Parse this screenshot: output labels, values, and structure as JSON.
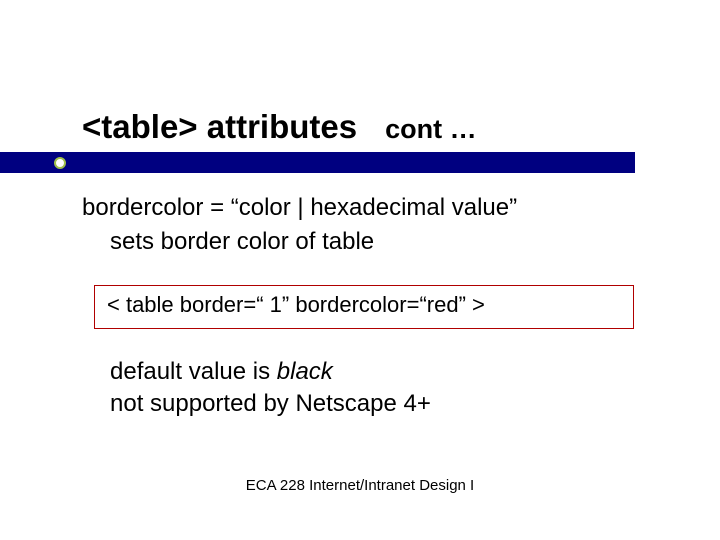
{
  "title": {
    "main": "<table> attributes",
    "cont": "cont …"
  },
  "body": {
    "line1": "bordercolor = “color | hexadecimal value”",
    "line2": "sets border color of table",
    "code": "< table border=“ 1” bordercolor=“red” >",
    "line3_prefix": "default value is ",
    "line3_italic": "black",
    "line4": "not supported by Netscape 4+"
  },
  "footer": "ECA 228  Internet/Intranet Design I"
}
